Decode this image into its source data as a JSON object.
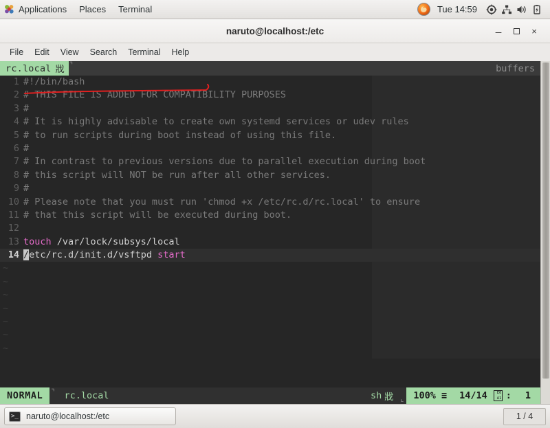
{
  "top_panel": {
    "apps_label": "Applications",
    "places_label": "Places",
    "terminal_label": "Terminal",
    "clock": "Tue 14:59",
    "icons": {
      "app_logo": "gnome-foot-icon",
      "browser": "firefox-icon",
      "location": "location-target-icon",
      "network": "network-wired-icon",
      "volume": "volume-speaker-icon",
      "battery": "battery-charging-icon"
    }
  },
  "window": {
    "title": "naruto@localhost:/etc",
    "minimize_label": "_",
    "maximize_label": "▫",
    "close_label": "×"
  },
  "menubar": {
    "items": [
      {
        "label": "File"
      },
      {
        "label": "Edit"
      },
      {
        "label": "View"
      },
      {
        "label": "Search"
      },
      {
        "label": "Terminal"
      },
      {
        "label": "Help"
      }
    ]
  },
  "vim": {
    "tabline": {
      "active_tab_label": "rc.local",
      "active_tab_modified_glyph": "戕",
      "separator_glyph": "⌝",
      "right_label": "buffers"
    },
    "lines": [
      {
        "num": "1",
        "segments": [
          {
            "text": "#!/bin/bash",
            "style": "cm"
          }
        ]
      },
      {
        "num": "2",
        "segments": [
          {
            "text": "# THIS FILE IS ADDED FOR COMPATIBILITY PURPOSES",
            "style": "cm"
          }
        ]
      },
      {
        "num": "3",
        "segments": [
          {
            "text": "#",
            "style": "cm"
          }
        ]
      },
      {
        "num": "4",
        "segments": [
          {
            "text": "# It is highly advisable to create own systemd services or udev rules",
            "style": "cm"
          }
        ]
      },
      {
        "num": "5",
        "segments": [
          {
            "text": "# to run scripts during boot instead of using this file.",
            "style": "cm"
          }
        ]
      },
      {
        "num": "6",
        "segments": [
          {
            "text": "#",
            "style": "cm"
          }
        ]
      },
      {
        "num": "7",
        "segments": [
          {
            "text": "# In contrast to previous versions due to parallel execution during boot",
            "style": "cm"
          }
        ]
      },
      {
        "num": "8",
        "segments": [
          {
            "text": "# this script will NOT be run after all other services.",
            "style": "cm"
          }
        ]
      },
      {
        "num": "9",
        "segments": [
          {
            "text": "#",
            "style": "cm"
          }
        ]
      },
      {
        "num": "10",
        "segments": [
          {
            "text": "# Please note that you must run 'chmod +x /etc/rc.d/rc.local' to ensure",
            "style": "cm"
          }
        ]
      },
      {
        "num": "11",
        "segments": [
          {
            "text": "# that this script will be executed during boot.",
            "style": "cm"
          }
        ]
      },
      {
        "num": "12",
        "segments": [
          {
            "text": "",
            "style": "ltext"
          }
        ]
      },
      {
        "num": "13",
        "segments": [
          {
            "text": "touch",
            "style": "kw"
          },
          {
            "text": " /var/lock/subsys/local",
            "style": "ltext"
          }
        ]
      },
      {
        "num": "14",
        "current": true,
        "segments": [
          {
            "text": "/",
            "style": "cursor-block"
          },
          {
            "text": "etc/rc.d/init.d/vsftpd ",
            "style": "ltext"
          },
          {
            "text": "start",
            "style": "kw"
          }
        ]
      }
    ],
    "empty_line_marker": "~",
    "empty_line_count": 8,
    "statusline": {
      "mode": "NORMAL",
      "separator_left_glyph": "⌝",
      "filename": "rc.local",
      "filetype": "sh",
      "filetype_glyph": "戕",
      "separator_right_glyph": "⌞",
      "percent": "100%",
      "lines_icon": "≡",
      "position": "14/14",
      "column_glyph_hex_top": "E0",
      "column_glyph_hex_bottom": "A1",
      "column_separator": ":",
      "column": "1"
    },
    "annotation": {
      "type": "red-underline-stroke",
      "color": "#e02020"
    }
  },
  "taskbar": {
    "task_label": "naruto@localhost:/etc",
    "task_icon": "terminal-prompt-icon",
    "task_icon_glyph": ">_",
    "workspace_label": "1 / 4"
  }
}
